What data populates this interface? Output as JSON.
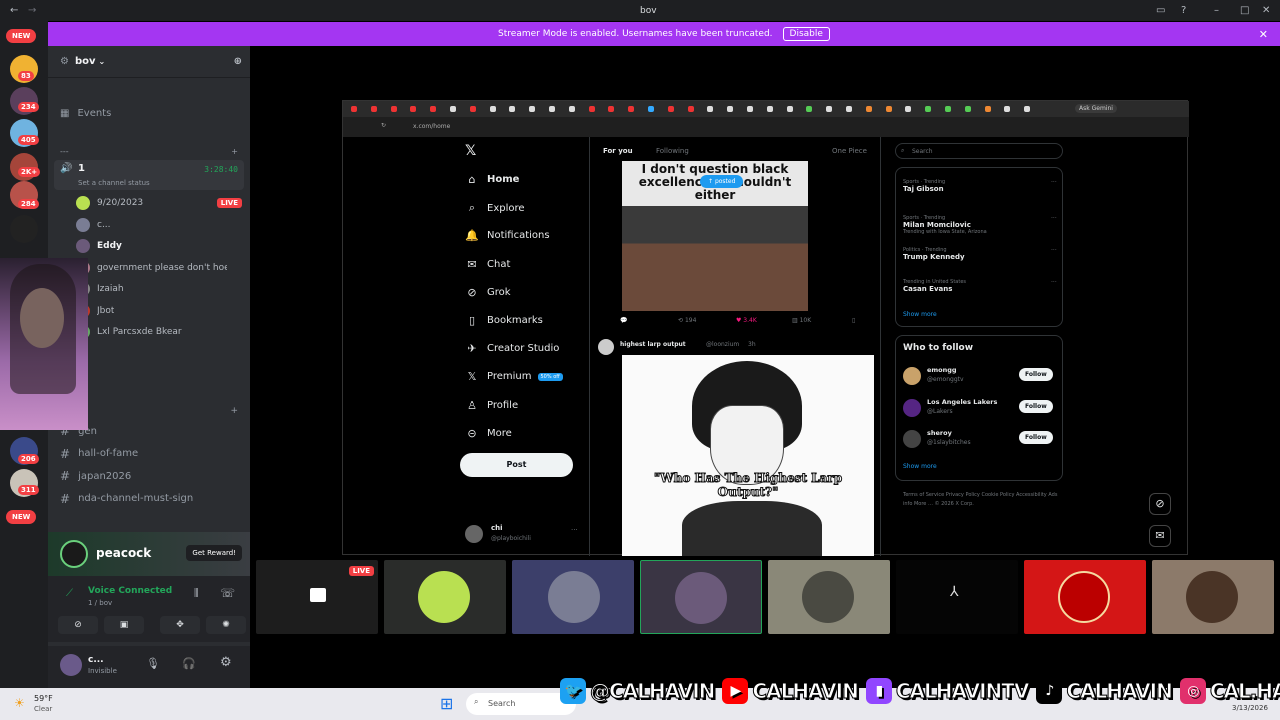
{
  "window": {
    "title": "bov"
  },
  "banner": {
    "text": "Streamer Mode is enabled. Usernames have been truncated.",
    "button": "Disable"
  },
  "guilds": {
    "new_top": "NEW",
    "new_bottom": "NEW",
    "badges": [
      "83",
      "234",
      "405",
      "2K+",
      "284",
      "206",
      "311"
    ]
  },
  "server": {
    "name": "bov"
  },
  "channels": {
    "events": "Events",
    "category": "---",
    "voice_channel": "1",
    "voice_timer": "3:28:40",
    "status_prompt": "Set a channel status",
    "members": [
      {
        "name": "9/20/2023",
        "live": "LIVE"
      },
      {
        "name": "c..."
      },
      {
        "name": "Eddy"
      },
      {
        "name": "government please don't hoe me"
      },
      {
        "name": "Izaiah"
      },
      {
        "name": "Jbot"
      },
      {
        "name": "Lxl Parcsxde Bkear"
      }
    ],
    "text_channels": [
      "gen",
      "hall-of-fame",
      "japan2026",
      "nda-channel-must-sign"
    ]
  },
  "promo": {
    "brand": "peacock",
    "button": "Get Reward!"
  },
  "voice": {
    "status": "Voice Connected",
    "location": "1 / bov"
  },
  "user": {
    "name": "c...",
    "status": "Invisible"
  },
  "x": {
    "url": "x.com/home",
    "ask": "Ask Gemini",
    "nav": [
      "Home",
      "Explore",
      "Notifications",
      "Chat",
      "Grok",
      "Bookmarks",
      "Creator Studio",
      "Premium",
      "Profile",
      "More"
    ],
    "premium_badge": "50% off",
    "post_button": "Post",
    "account": {
      "name": "chi",
      "handle": "@playboichili"
    },
    "feed_tabs": [
      "For you",
      "Following",
      "One Piece"
    ],
    "posted_pill": "posted",
    "post1_caption": "I don't question black excellence U shouldn't either",
    "post1_stats": {
      "replies": "",
      "reposts": "194",
      "likes": "3.4K",
      "views": "10K"
    },
    "post2": {
      "author": "highest larp output",
      "handle": "@loonzium",
      "time": "3h",
      "caption": "\"Who Has The Highest Larp Output?\""
    },
    "search_placeholder": "Search",
    "trends": [
      {
        "context": "Sports · Trending",
        "name": "Taj Gibson",
        "extra": ""
      },
      {
        "context": "Sports · Trending",
        "name": "Milan Momcilovic",
        "extra": "Trending with Iowa State, Arizona"
      },
      {
        "context": "Politics · Trending",
        "name": "Trump Kennedy",
        "extra": ""
      },
      {
        "context": "Trending in United States",
        "name": "Casan Evans",
        "extra": ""
      }
    ],
    "show_more": "Show more",
    "who_to_follow": "Who to follow",
    "follows": [
      {
        "name": "emongg",
        "handle": "@emonggtv",
        "button": "Follow"
      },
      {
        "name": "Los Angeles Lakers",
        "handle": "@Lakers",
        "button": "Follow"
      },
      {
        "name": "sheroy",
        "handle": "@1slaybitches",
        "button": "Follow"
      }
    ],
    "show_more2": "Show more",
    "footer": "Terms of Service   Privacy Policy   Cookie Policy   Accessibility   Ads info   More …   © 2026 X Corp."
  },
  "stream_strip": {
    "live": "LIVE"
  },
  "taskbar": {
    "temp": "59°F",
    "weather": "Clear",
    "search": "Search",
    "date": "3/13/2026"
  },
  "socials": [
    {
      "icon": "twitter-icon",
      "text": "@CALHAVIN",
      "color": "#1da1f2"
    },
    {
      "icon": "youtube-icon",
      "text": "CALHAVIN",
      "color": "#ff0000"
    },
    {
      "icon": "twitch-icon",
      "text": "CALHAVINTV",
      "color": "#9146ff"
    },
    {
      "icon": "tiktok-icon",
      "text": "CALHAVIN",
      "color": "#000000"
    },
    {
      "icon": "instagram-icon",
      "text": "CAL.HAVIN",
      "color": "#e1306c"
    }
  ]
}
